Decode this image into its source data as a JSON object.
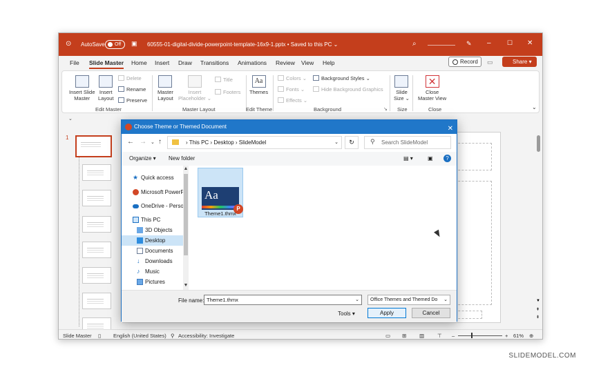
{
  "window": {
    "autosave_label": "AutoSave",
    "autosave_state": "Off",
    "document_title": "60555-01-digital-divide-powerpoint-template-16x9-1.pptx • Saved to this PC ⌄",
    "accent_color": "#c43e1c"
  },
  "menu": {
    "items": [
      "File",
      "Slide Master",
      "Home",
      "Insert",
      "Draw",
      "Transitions",
      "Animations",
      "Review",
      "View",
      "Help"
    ],
    "active": "Slide Master",
    "record_label": "Record",
    "share_label": "Share"
  },
  "ribbon": {
    "insert_slide_master": "Insert Slide\nMaster",
    "insert_layout": "Insert\nLayout",
    "delete": "Delete",
    "rename": "Rename",
    "preserve": "Preserve",
    "master_layout": "Master\nLayout",
    "insert_placeholder": "Insert\nPlaceholder ⌄",
    "title": "Title",
    "footers": "Footers",
    "themes": "Themes",
    "colors": "Colors ⌄",
    "fonts": "Fonts ⌄",
    "effects": "Effects ⌄",
    "background_styles": "Background Styles ⌄",
    "hide_background_graphics": "Hide Background Graphics",
    "slide_size": "Slide\nSize ⌄",
    "close_master_view": "Close\nMaster View",
    "groups": {
      "edit_master": "Edit Master",
      "master_layout": "Master Layout",
      "edit_theme": "Edit Theme",
      "background": "Background",
      "size": "Size",
      "close": "Close"
    }
  },
  "thumbnails": {
    "slide_number": "1"
  },
  "statusbar": {
    "mode": "Slide Master",
    "language": "English (United States)",
    "accessibility": "Accessibility: Investigate",
    "zoom": "61%"
  },
  "dialog": {
    "title": "Choose Theme or Themed Document",
    "breadcrumb": [
      "This PC",
      "Desktop",
      "SlideModel"
    ],
    "search_placeholder": "Search SlideModel",
    "organize_label": "Organize ▾",
    "new_folder_label": "New folder",
    "nav_items": [
      {
        "label": "Quick access",
        "icon": "star-icon"
      },
      {
        "label": "Microsoft PowerP",
        "icon": "powerpoint-icon"
      },
      {
        "label": "OneDrive - Persor",
        "icon": "cloud-icon"
      },
      {
        "label": "This PC",
        "icon": "computer-icon"
      },
      {
        "label": "3D Objects",
        "icon": "cube-icon"
      },
      {
        "label": "Desktop",
        "icon": "desktop-icon"
      },
      {
        "label": "Documents",
        "icon": "document-icon"
      },
      {
        "label": "Downloads",
        "icon": "download-icon"
      },
      {
        "label": "Music",
        "icon": "music-icon"
      },
      {
        "label": "Pictures",
        "icon": "picture-icon"
      }
    ],
    "selected_nav": "Desktop",
    "file": {
      "thumbnail_text": "Aa",
      "name": "Theme1.thmx"
    },
    "file_name_label": "File name:",
    "file_name_value": "Theme1.thmx",
    "file_type": "Office Themes and Themed Do",
    "tools_label": "Tools",
    "apply_label": "Apply",
    "cancel_label": "Cancel"
  },
  "branding": {
    "watermark": "SLIDEMODEL.COM"
  }
}
